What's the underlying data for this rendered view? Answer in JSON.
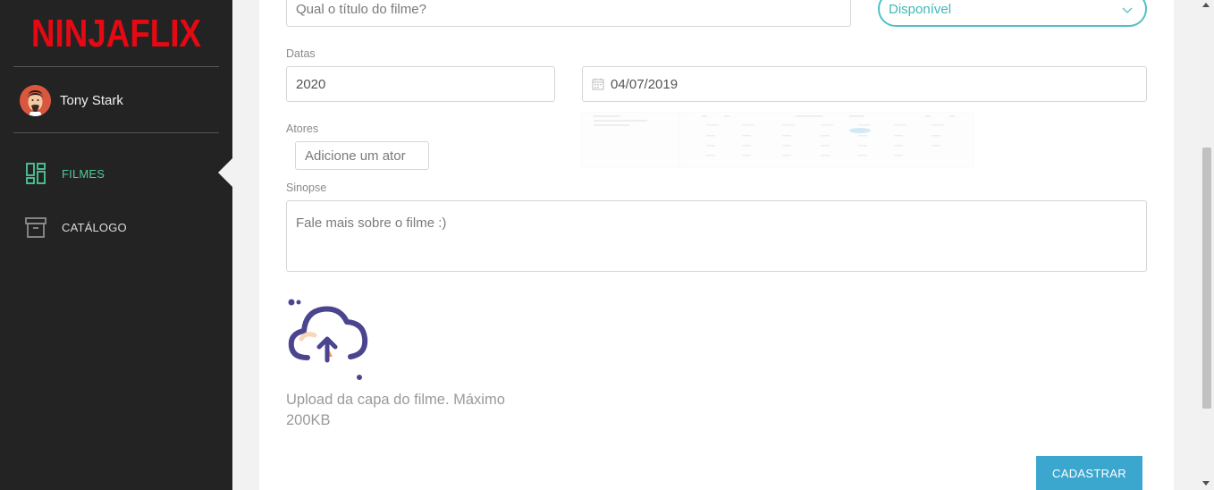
{
  "brand": {
    "logo_text": "NINJAFLIX",
    "color": "#e50914"
  },
  "user": {
    "name": "Tony Stark"
  },
  "sidebar": {
    "items": [
      {
        "label": "FILMES",
        "icon": "dashboard-icon",
        "active": true
      },
      {
        "label": "CATÁLOGO",
        "icon": "archive-box-icon",
        "active": false
      }
    ]
  },
  "form": {
    "title_placeholder": "Qual o título do filme?",
    "status_value": "Disponível",
    "dates_label": "Datas",
    "year_value": "2020",
    "release_date_value": "04/07/2019",
    "actors_label": "Atores",
    "actors_placeholder": "Adicione um ator",
    "synopsis_label": "Sinopse",
    "synopsis_placeholder": "Fale mais sobre o filme :)",
    "upload_text": "Upload da capa do filme. Máximo 200KB",
    "submit_label": "CADASTRAR"
  },
  "colors": {
    "sidebar_bg": "#232323",
    "accent_green": "#4dcc9a",
    "accent_teal": "#4ec2c2",
    "button_blue": "#3ba7cf",
    "upload_icon": "#4b4590"
  }
}
